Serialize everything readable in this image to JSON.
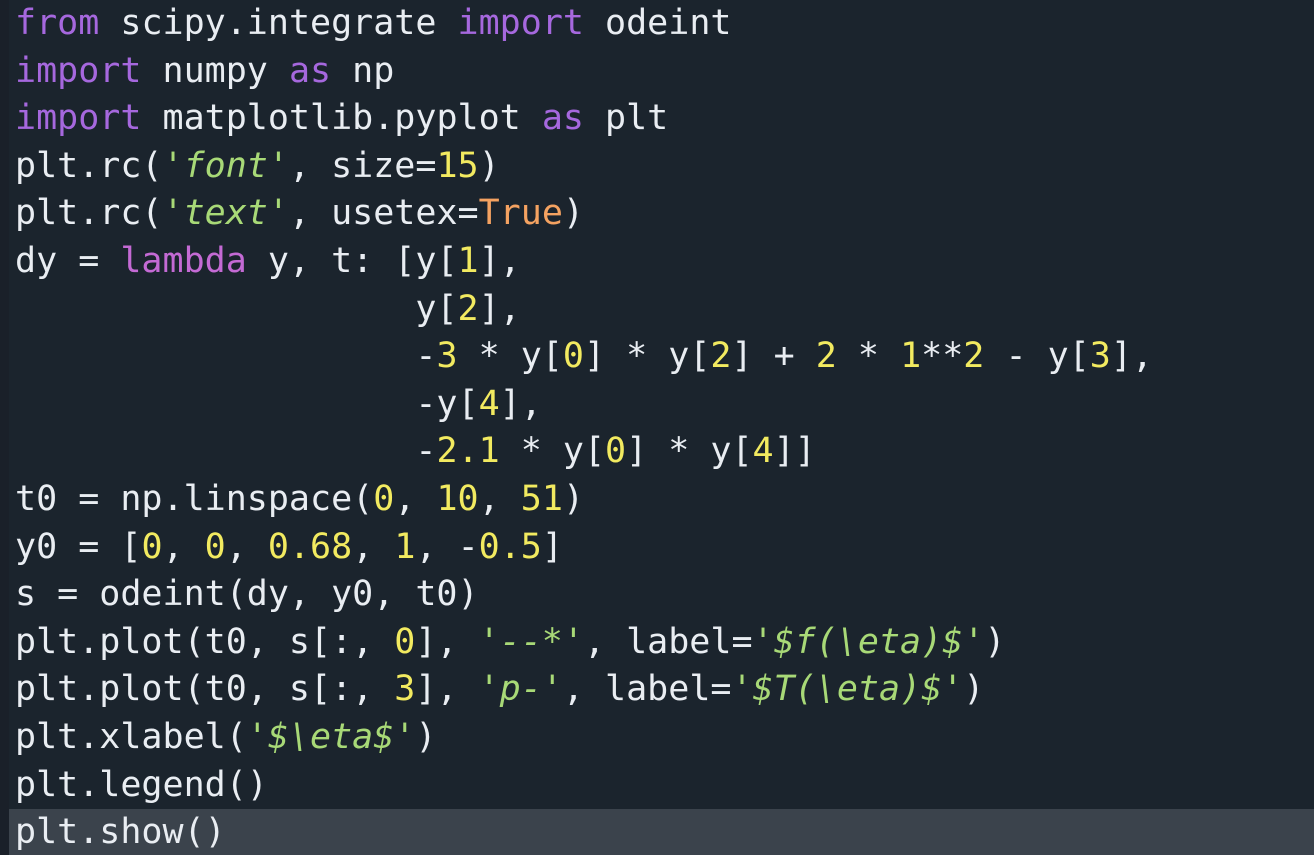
{
  "editor": {
    "language": "python",
    "theme": "dark",
    "background_color": "#1b242d",
    "gutter_color": "#1a2029",
    "current_line_highlight_color": "#3b434c",
    "default_text_color": "#e9edf2",
    "current_line_number": 18,
    "total_lines": 18,
    "font_size_px": 35
  },
  "syntax_colors": {
    "keyword_import": "#a668de",
    "keyword_lambda": "#c46ad4",
    "string": "#a8d977",
    "number": "#f2ea60",
    "constant": "#f4a261",
    "plain": "#e9edf2"
  },
  "code": {
    "full_text": "from scipy.integrate import odeint\nimport numpy as np\nimport matplotlib.pyplot as plt\nplt.rc('font', size=15)\nplt.rc('text', usetex=True)\ndy = lambda y, t: [y[1],\n                   y[2],\n                   -3 * y[0] * y[2] + 2 * 1**2 - y[3],\n                   -y[4],\n                   -2.1 * y[0] * y[4]]\nt0 = np.linspace(0, 10, 51)\ny0 = [0, 0, 0.68, 1, -0.5]\ns = odeint(dy, y0, t0)\nplt.plot(t0, s[:, 0], '--*', label='$f(\\\\eta)$')\nplt.plot(t0, s[:, 3], 'p-', label='$T(\\\\eta)$')\nplt.xlabel('$\\\\eta$')\nplt.legend()\nplt.show()",
    "lines": [
      {
        "n": 1,
        "current": false,
        "tokens": [
          {
            "t": "from",
            "c": "kw-import"
          },
          {
            "t": " scipy.integrate ",
            "c": "plain"
          },
          {
            "t": "import",
            "c": "kw-import"
          },
          {
            "t": " odeint",
            "c": "plain"
          }
        ]
      },
      {
        "n": 2,
        "current": false,
        "tokens": [
          {
            "t": "import",
            "c": "kw-import"
          },
          {
            "t": " numpy ",
            "c": "plain"
          },
          {
            "t": "as",
            "c": "kw-import"
          },
          {
            "t": " np",
            "c": "plain"
          }
        ]
      },
      {
        "n": 3,
        "current": false,
        "tokens": [
          {
            "t": "import",
            "c": "kw-import"
          },
          {
            "t": " matplotlib.pyplot ",
            "c": "plain"
          },
          {
            "t": "as",
            "c": "kw-import"
          },
          {
            "t": " plt",
            "c": "plain"
          }
        ]
      },
      {
        "n": 4,
        "current": false,
        "tokens": [
          {
            "t": "plt.rc(",
            "c": "plain"
          },
          {
            "t": "'font'",
            "c": "str"
          },
          {
            "t": ", size=",
            "c": "plain"
          },
          {
            "t": "15",
            "c": "num"
          },
          {
            "t": ")",
            "c": "plain"
          }
        ]
      },
      {
        "n": 5,
        "current": false,
        "tokens": [
          {
            "t": "plt.rc(",
            "c": "plain"
          },
          {
            "t": "'text'",
            "c": "str"
          },
          {
            "t": ", usetex=",
            "c": "plain"
          },
          {
            "t": "True",
            "c": "const"
          },
          {
            "t": ")",
            "c": "plain"
          }
        ]
      },
      {
        "n": 6,
        "current": false,
        "tokens": [
          {
            "t": "dy = ",
            "c": "plain"
          },
          {
            "t": "lambda",
            "c": "kw-lambda"
          },
          {
            "t": " y, t: [y[",
            "c": "plain"
          },
          {
            "t": "1",
            "c": "num"
          },
          {
            "t": "],",
            "c": "plain"
          }
        ]
      },
      {
        "n": 7,
        "current": false,
        "tokens": [
          {
            "t": "                   y[",
            "c": "plain"
          },
          {
            "t": "2",
            "c": "num"
          },
          {
            "t": "],",
            "c": "plain"
          }
        ]
      },
      {
        "n": 8,
        "current": false,
        "tokens": [
          {
            "t": "                   -",
            "c": "plain"
          },
          {
            "t": "3",
            "c": "num"
          },
          {
            "t": " * y[",
            "c": "plain"
          },
          {
            "t": "0",
            "c": "num"
          },
          {
            "t": "] * y[",
            "c": "plain"
          },
          {
            "t": "2",
            "c": "num"
          },
          {
            "t": "] + ",
            "c": "plain"
          },
          {
            "t": "2",
            "c": "num"
          },
          {
            "t": " * ",
            "c": "plain"
          },
          {
            "t": "1",
            "c": "num"
          },
          {
            "t": "**",
            "c": "plain"
          },
          {
            "t": "2",
            "c": "num"
          },
          {
            "t": " - y[",
            "c": "plain"
          },
          {
            "t": "3",
            "c": "num"
          },
          {
            "t": "],",
            "c": "plain"
          }
        ]
      },
      {
        "n": 9,
        "current": false,
        "tokens": [
          {
            "t": "                   -y[",
            "c": "plain"
          },
          {
            "t": "4",
            "c": "num"
          },
          {
            "t": "],",
            "c": "plain"
          }
        ]
      },
      {
        "n": 10,
        "current": false,
        "tokens": [
          {
            "t": "                   -",
            "c": "plain"
          },
          {
            "t": "2.1",
            "c": "num"
          },
          {
            "t": " * y[",
            "c": "plain"
          },
          {
            "t": "0",
            "c": "num"
          },
          {
            "t": "] * y[",
            "c": "plain"
          },
          {
            "t": "4",
            "c": "num"
          },
          {
            "t": "]]",
            "c": "plain"
          }
        ]
      },
      {
        "n": 11,
        "current": false,
        "tokens": [
          {
            "t": "t0 = np.linspace(",
            "c": "plain"
          },
          {
            "t": "0",
            "c": "num"
          },
          {
            "t": ", ",
            "c": "plain"
          },
          {
            "t": "10",
            "c": "num"
          },
          {
            "t": ", ",
            "c": "plain"
          },
          {
            "t": "51",
            "c": "num"
          },
          {
            "t": ")",
            "c": "plain"
          }
        ]
      },
      {
        "n": 12,
        "current": false,
        "tokens": [
          {
            "t": "y0 = [",
            "c": "plain"
          },
          {
            "t": "0",
            "c": "num"
          },
          {
            "t": ", ",
            "c": "plain"
          },
          {
            "t": "0",
            "c": "num"
          },
          {
            "t": ", ",
            "c": "plain"
          },
          {
            "t": "0.68",
            "c": "num"
          },
          {
            "t": ", ",
            "c": "plain"
          },
          {
            "t": "1",
            "c": "num"
          },
          {
            "t": ", -",
            "c": "plain"
          },
          {
            "t": "0.5",
            "c": "num"
          },
          {
            "t": "]",
            "c": "plain"
          }
        ]
      },
      {
        "n": 13,
        "current": false,
        "tokens": [
          {
            "t": "s = odeint(dy, y0, t0)",
            "c": "plain"
          }
        ]
      },
      {
        "n": 14,
        "current": false,
        "tokens": [
          {
            "t": "plt.plot(t0, s[:, ",
            "c": "plain"
          },
          {
            "t": "0",
            "c": "num"
          },
          {
            "t": "], ",
            "c": "plain"
          },
          {
            "t": "'--*'",
            "c": "str"
          },
          {
            "t": ", label=",
            "c": "plain"
          },
          {
            "t": "'$f(\\eta)$'",
            "c": "str"
          },
          {
            "t": ")",
            "c": "plain"
          }
        ]
      },
      {
        "n": 15,
        "current": false,
        "tokens": [
          {
            "t": "plt.plot(t0, s[:, ",
            "c": "plain"
          },
          {
            "t": "3",
            "c": "num"
          },
          {
            "t": "], ",
            "c": "plain"
          },
          {
            "t": "'p-'",
            "c": "str"
          },
          {
            "t": ", label=",
            "c": "plain"
          },
          {
            "t": "'$T(\\eta)$'",
            "c": "str"
          },
          {
            "t": ")",
            "c": "plain"
          }
        ]
      },
      {
        "n": 16,
        "current": false,
        "tokens": [
          {
            "t": "plt.xlabel(",
            "c": "plain"
          },
          {
            "t": "'$\\eta$'",
            "c": "str"
          },
          {
            "t": ")",
            "c": "plain"
          }
        ]
      },
      {
        "n": 17,
        "current": false,
        "tokens": [
          {
            "t": "plt.legend()",
            "c": "plain"
          }
        ]
      },
      {
        "n": 18,
        "current": true,
        "tokens": [
          {
            "t": "plt.show()",
            "c": "plain"
          }
        ]
      }
    ]
  }
}
